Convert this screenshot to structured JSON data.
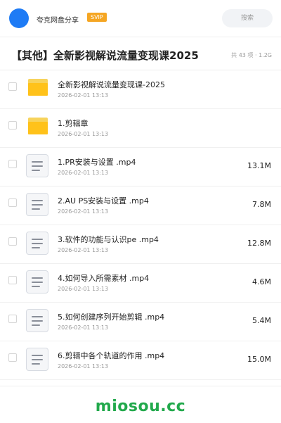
{
  "header": {
    "app_name": "夸克网盘分享",
    "badge": "SVIP",
    "search_placeholder": "搜索"
  },
  "title": "【其他】全新影视解说流量变现课2025",
  "meta": "共 43 项 · 1.2G",
  "items": [
    {
      "type": "folder",
      "name": "全新影视解说流量变现课-2025",
      "date": "2026-02-01 13:13",
      "size": ""
    },
    {
      "type": "folder",
      "name": "1.剪辑章",
      "date": "2026-02-01 13:13",
      "size": ""
    },
    {
      "type": "file",
      "name": "1.PR安装与设置 .mp4",
      "date": "2026-02-01 13:13",
      "size": "13.1M"
    },
    {
      "type": "file",
      "name": "2.AU PS安装与设置 .mp4",
      "date": "2026-02-01 13:13",
      "size": "7.8M"
    },
    {
      "type": "file",
      "name": "3.软件的功能与认识pe .mp4",
      "date": "2026-02-01 13:13",
      "size": "12.8M"
    },
    {
      "type": "file",
      "name": "4.如何导入所需素材 .mp4",
      "date": "2026-02-01 13:13",
      "size": "4.6M"
    },
    {
      "type": "file",
      "name": "5.如何创建序列开始剪辑 .mp4",
      "date": "2026-02-01 13:13",
      "size": "5.4M"
    },
    {
      "type": "file",
      "name": "6.剪辑中各个轨道的作用 .mp4",
      "date": "2026-02-01 13:13",
      "size": "15.0M"
    }
  ],
  "watermark": "miosou.cc",
  "colors": {
    "accent": "#1e7bf5",
    "badge": "#f5a623",
    "folder": "#ffc21a",
    "watermark": "#22a94c"
  }
}
